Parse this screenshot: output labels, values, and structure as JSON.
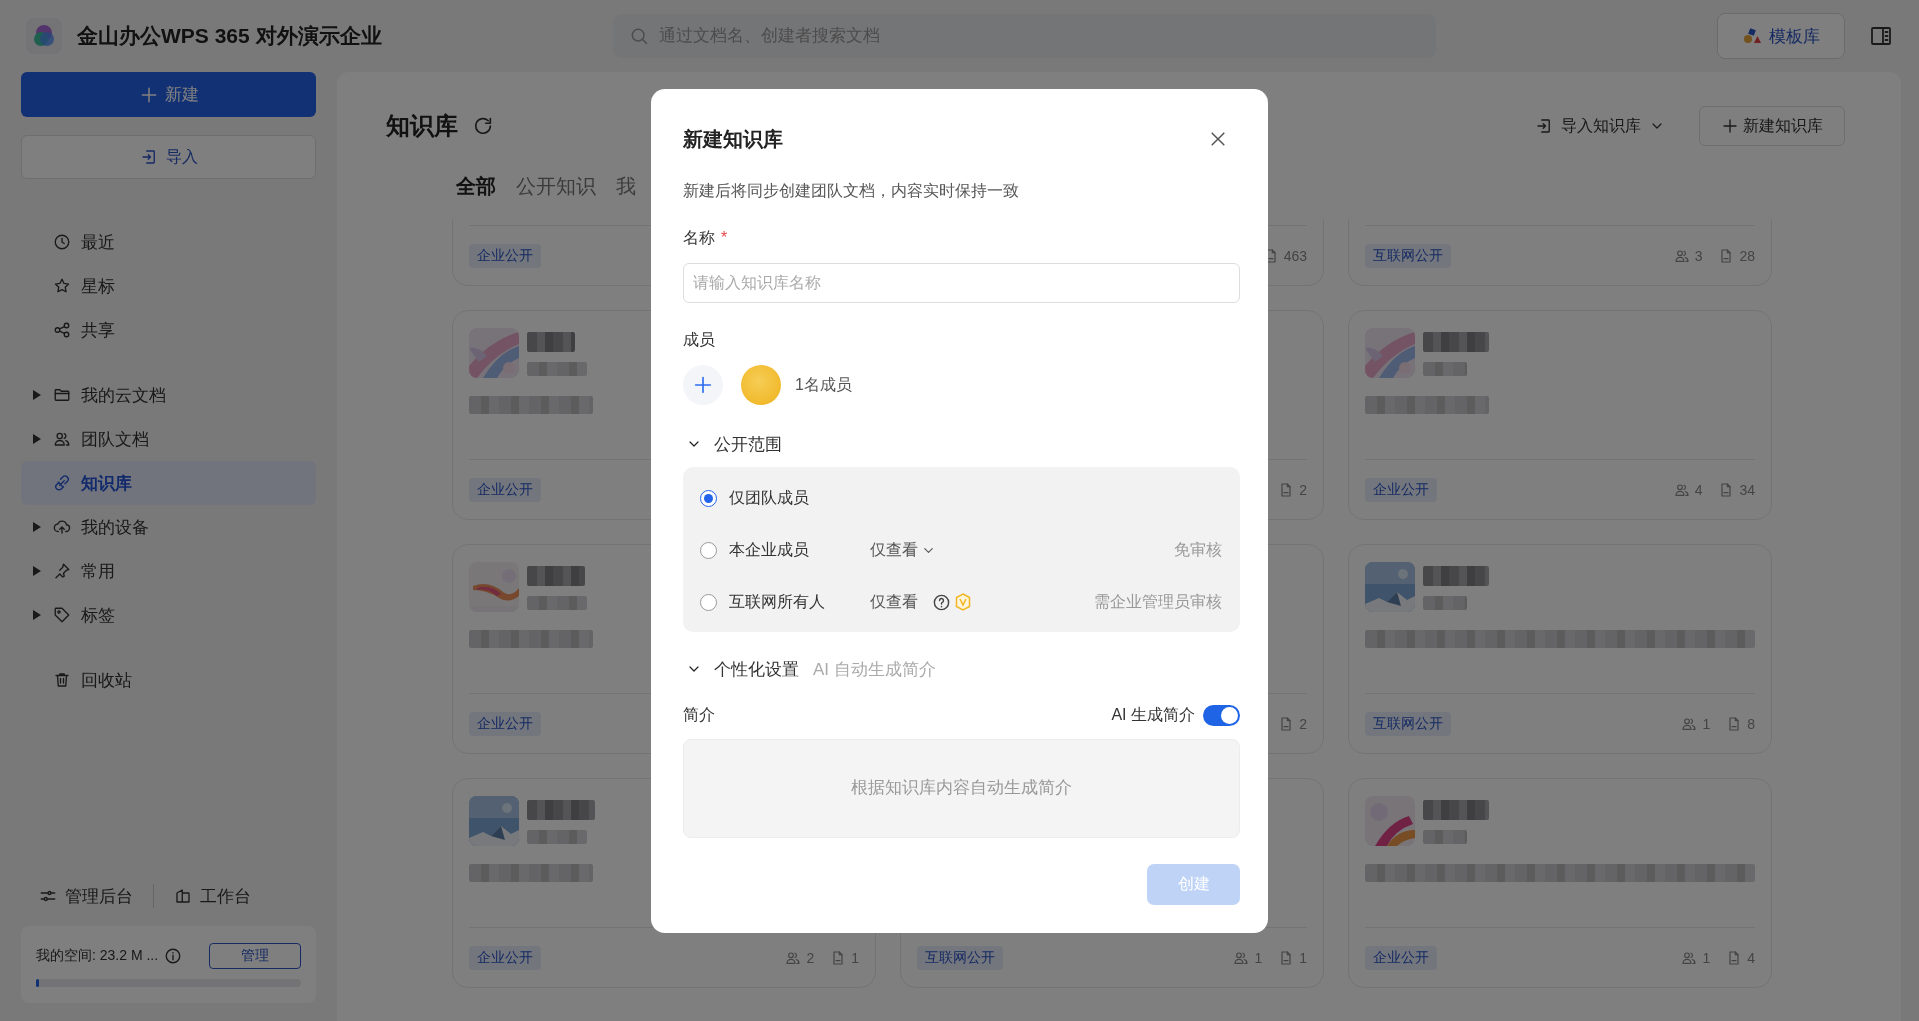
{
  "app": {
    "title": "金山办公WPS 365 对外演示企业"
  },
  "search": {
    "placeholder": "通过文档名、创建者搜索文档"
  },
  "template_button": "模板库",
  "sidebar": {
    "new_button": "新建",
    "import_button": "导入",
    "groups": [
      [
        {
          "label": "最近",
          "kind": "clock",
          "expandable": false,
          "selected": false
        },
        {
          "label": "星标",
          "kind": "star",
          "expandable": false,
          "selected": false
        },
        {
          "label": "共享",
          "kind": "share",
          "expandable": false,
          "selected": false
        }
      ],
      [
        {
          "label": "我的云文档",
          "kind": "folder",
          "expandable": true,
          "selected": false
        },
        {
          "label": "团队文档",
          "kind": "team",
          "expandable": true,
          "selected": false
        },
        {
          "label": "知识库",
          "kind": "knowledge",
          "expandable": false,
          "selected": true
        },
        {
          "label": "我的设备",
          "kind": "cloud",
          "expandable": true,
          "selected": false
        },
        {
          "label": "常用",
          "kind": "pin",
          "expandable": true,
          "selected": false
        },
        {
          "label": "标签",
          "kind": "tag",
          "expandable": true,
          "selected": false
        }
      ],
      [
        {
          "label": "回收站",
          "kind": "trash",
          "expandable": false,
          "selected": false
        }
      ]
    ],
    "footer_links": [
      {
        "label": "管理后台",
        "kind": "sliders"
      },
      {
        "label": "工作台",
        "kind": "workbench"
      }
    ],
    "storage": {
      "label": "我的空间: 23.2 M ...",
      "button": "管理",
      "level": 0.01
    }
  },
  "main": {
    "title": "知识库",
    "import_menu": "导入知识库",
    "new_button": "新建知识库",
    "tabs": [
      {
        "label": "全部",
        "selected": true
      },
      {
        "label": "公开知识",
        "selected": false
      },
      {
        "label": "我",
        "selected": false
      }
    ],
    "card_rows": [
      [
        {
          "kind": "cut",
          "tag": "企业公开"
        },
        {
          "kind": "cut",
          "docs": "463"
        },
        {
          "kind": "cut",
          "tag": "互联网公开",
          "members": "3",
          "docs": "28"
        }
      ],
      [
        {
          "kind": "full",
          "tag": "企业公开"
        },
        {
          "kind": "covered",
          "docs": "2"
        },
        {
          "kind": "full",
          "tag": "企业公开",
          "members": "4",
          "docs": "34"
        }
      ],
      [
        {
          "kind": "full",
          "tag": "企业公开"
        },
        {
          "kind": "covered",
          "docs": "2"
        },
        {
          "kind": "full",
          "tag": "互联网公开",
          "members": "1",
          "docs": "8"
        }
      ],
      [
        {
          "kind": "full",
          "tag": "企业公开",
          "members": "2",
          "docs": "1"
        },
        {
          "kind": "covered",
          "tag": "互联网公开",
          "members": "1",
          "docs": "1"
        },
        {
          "kind": "full",
          "tag": "企业公开",
          "members": "1",
          "docs": "4"
        }
      ]
    ]
  },
  "dialog": {
    "title": "新建知识库",
    "subtitle": "新建后将同步创建团队文档，内容实时保持一致",
    "name_label": "名称",
    "required_mark": "*",
    "name_field": {
      "placeholder": "请输入知识库名称"
    },
    "members_label": "成员",
    "member_count": "1名成员",
    "visibility": {
      "label": "公开范围",
      "expanded": true,
      "options": [
        {
          "label": "仅团队成员",
          "selected": true,
          "kind": "plain"
        },
        {
          "label": "本企业成员",
          "selected": false,
          "kind": "dropdown",
          "permission": "仅查看",
          "review": "免审核"
        },
        {
          "label": "互联网所有人",
          "selected": false,
          "kind": "help",
          "permission": "仅查看",
          "review": "需企业管理员审核"
        }
      ]
    },
    "personalize": {
      "label": "个性化设置",
      "hint": "AI 自动生成简介",
      "expanded": true
    },
    "intro_label": "简介",
    "ai_toggle": {
      "label": "AI 生成简介",
      "on": true
    },
    "intro_field": {
      "placeholder": "根据知识库内容自动生成简介"
    },
    "create_button": {
      "label": "创建",
      "disabled": true
    }
  }
}
